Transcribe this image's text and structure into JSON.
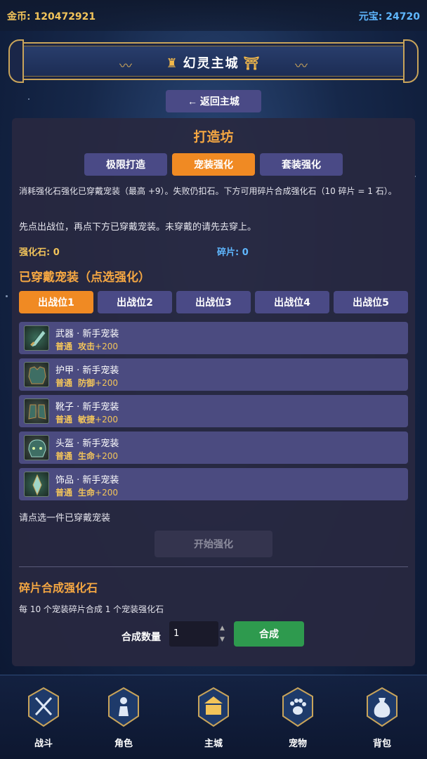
{
  "topbar": {
    "gold_label": "金币:",
    "gold_value": "120472921",
    "yuan_label": "元宝:",
    "yuan_value": "24720"
  },
  "banner": {
    "title": "幻灵主城"
  },
  "back_button": "← 返回主城",
  "workshop": {
    "title": "打造坊",
    "tabs": [
      {
        "label": "极限打造",
        "active": false
      },
      {
        "label": "宠装强化",
        "active": true
      },
      {
        "label": "套装强化",
        "active": false
      }
    ],
    "desc1": "消耗强化石强化已穿戴宠装（最高 +9）。失败仍扣石。下方可用碎片合成强化石（10 碎片 = 1 石）。",
    "desc2": "先点出战位，再点下方已穿戴宠装。未穿戴的请先去穿上。",
    "stone_label": "强化石:",
    "stone_value": "0",
    "fragment_label": "碎片:",
    "fragment_value": "0",
    "equipped_title": "已穿戴宠装（点选强化）",
    "slots": [
      {
        "label": "出战位1",
        "active": true
      },
      {
        "label": "出战位2",
        "active": false
      },
      {
        "label": "出战位3",
        "active": false
      },
      {
        "label": "出战位4",
        "active": false
      },
      {
        "label": "出战位5",
        "active": false
      }
    ],
    "equipment": [
      {
        "name": "武器 · 新手宠装",
        "rarity": "普通",
        "attr": "攻击",
        "bonus": "+200",
        "icon": "dagger-icon"
      },
      {
        "name": "护甲 · 新手宠装",
        "rarity": "普通",
        "attr": "防御",
        "bonus": "+200",
        "icon": "armor-icon"
      },
      {
        "name": "靴子 · 新手宠装",
        "rarity": "普通",
        "attr": "敏捷",
        "bonus": "+200",
        "icon": "boots-icon"
      },
      {
        "name": "头盔 · 新手宠装",
        "rarity": "普通",
        "attr": "生命",
        "bonus": "+200",
        "icon": "helmet-icon"
      },
      {
        "name": "饰品 · 新手宠装",
        "rarity": "普通",
        "attr": "生命",
        "bonus": "+200",
        "icon": "ornament-icon"
      }
    ],
    "hint": "请点选一件已穿戴宠装",
    "start_button": "开始强化",
    "fragment_section_title": "碎片合成强化石",
    "fragment_desc": "每 10 个宠装碎片合成 1 个宠装强化石",
    "qty_label": "合成数量",
    "qty_value": "1",
    "synth_button": "合成"
  },
  "nav": [
    {
      "label": "战斗",
      "icon": "crossed-swords-icon"
    },
    {
      "label": "角色",
      "icon": "character-icon"
    },
    {
      "label": "主城",
      "icon": "palace-icon"
    },
    {
      "label": "宠物",
      "icon": "paw-icon"
    },
    {
      "label": "背包",
      "icon": "bag-icon"
    }
  ],
  "colors": {
    "accent": "#f08a23",
    "tab": "#4a4a86",
    "gold": "#f2c45a",
    "yuan": "#5fb7ff",
    "confirm": "#2e9a4e"
  }
}
